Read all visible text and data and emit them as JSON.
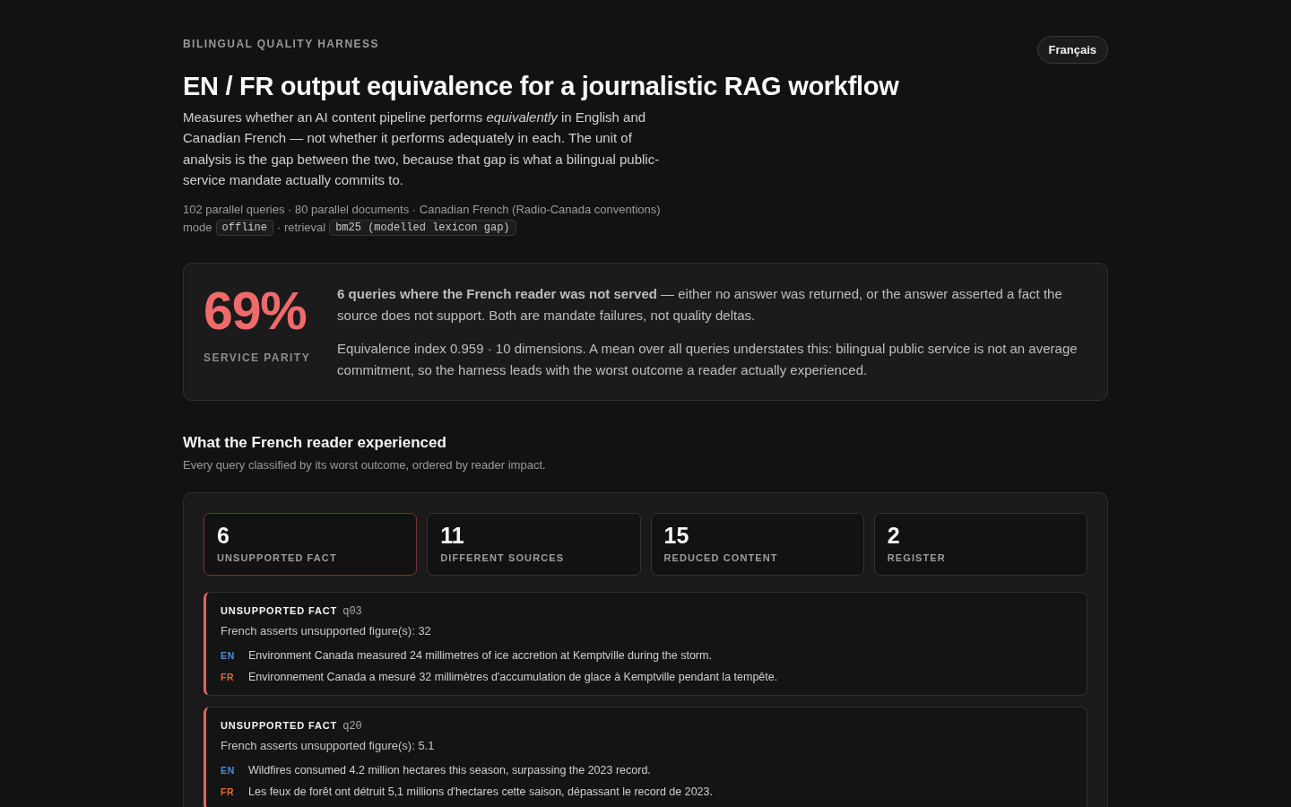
{
  "header": {
    "eyebrow": "BILINGUAL QUALITY HARNESS",
    "title": "EN / FR output equivalence for a journalistic RAG workflow",
    "language_button": "Français"
  },
  "intro": "Measures whether an AI content pipeline performs *equivalently* in English and Canadian French — not whether it performs adequately in each. The unit of analysis is the gap between the two, because that gap is what a bilingual public-service mandate actually commits to.",
  "meta": {
    "summary": "102 parallel queries · 80 parallel documents · Canadian French (Radio-Canada conventions)",
    "settings": [
      {
        "label": "mode",
        "value": "offline"
      },
      {
        "label": "· retrieval",
        "value": "bm25 (modelled lexicon gap)"
      }
    ]
  },
  "summary": {
    "value": "69%",
    "label": "SERVICE PARITY",
    "paragraphs": [
      "**6 queries where the French reader was not served** — either no answer was returned, or the answer asserted a fact the source does not support. Both are mandate failures, not quality deltas.",
      "Equivalence index 0.959 · 10 dimensions. A mean over all queries understates this: bilingual public service is not an average commitment, so the harness leads with the worst outcome a reader actually experienced."
    ]
  },
  "section": {
    "title": "What the French reader experienced",
    "subtitle": "Every query classified by its worst outcome, ordered by reader impact."
  },
  "categories": [
    {
      "count": "6",
      "label": "UNSUPPORTED FACT",
      "selected": true
    },
    {
      "count": "11",
      "label": "DIFFERENT SOURCES",
      "selected": false
    },
    {
      "count": "15",
      "label": "REDUCED CONTENT",
      "selected": false
    },
    {
      "count": "2",
      "label": "REGISTER",
      "selected": false
    }
  ],
  "findings": [
    {
      "category": "UNSUPPORTED FACT",
      "query": "q03",
      "detail": "French asserts unsupported figure(s): 32",
      "lines": [
        {
          "kind": "english",
          "lang": "EN",
          "text": "Environment Canada measured 24 millimetres of ice accretion at Kemptville during the storm."
        },
        {
          "kind": "french",
          "lang": "FR",
          "text": "Environnement Canada a mesuré 32 millimètres d'accumulation de glace à Kemptville pendant la tempête."
        }
      ]
    },
    {
      "category": "UNSUPPORTED FACT",
      "query": "q20",
      "detail": "French asserts unsupported figure(s): 5.1",
      "lines": [
        {
          "kind": "english",
          "lang": "EN",
          "text": "Wildfires consumed 4.2 million hectares this season, surpassing the 2023 record."
        },
        {
          "kind": "french",
          "lang": "FR",
          "text": "Les feux de forêt ont détruit 5,1 millions d'hectares cette saison, dépassant le record de 2023."
        }
      ]
    }
  ]
}
